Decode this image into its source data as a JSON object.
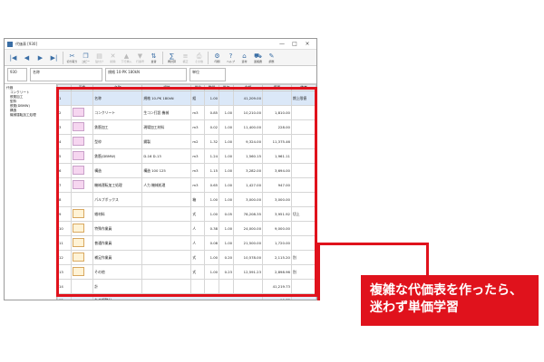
{
  "window": {
    "title": "代価表 [930]",
    "controls": [
      "—",
      "□",
      "×"
    ]
  },
  "toolbar": {
    "buttons": [
      {
        "icon": "first-icon",
        "glyph": "|◀",
        "label": "",
        "enabled": true
      },
      {
        "icon": "prev-icon",
        "glyph": "◀",
        "label": "",
        "enabled": true
      },
      {
        "icon": "next-icon",
        "glyph": "▶",
        "label": "",
        "enabled": true
      },
      {
        "icon": "last-icon",
        "glyph": "▶|",
        "label": "",
        "enabled": true
      },
      {
        "icon": "cut-icon",
        "glyph": "✂",
        "label": "切り取り",
        "enabled": true
      },
      {
        "icon": "copy-icon",
        "glyph": "❐",
        "label": "コピー",
        "enabled": true
      },
      {
        "icon": "paste-icon",
        "glyph": "▤",
        "label": "貼付け",
        "enabled": false
      },
      {
        "icon": "delete-icon",
        "glyph": "✕",
        "label": "削除",
        "enabled": false
      },
      {
        "icon": "insert-up-icon",
        "glyph": "▲",
        "label": "下行挿入",
        "enabled": false
      },
      {
        "icon": "insert-down-icon",
        "glyph": "▼",
        "label": "行番号",
        "enabled": false
      },
      {
        "icon": "sort-icon",
        "glyph": "⇅",
        "label": "並替",
        "enabled": true
      },
      {
        "icon": "calc-icon",
        "glyph": "∑",
        "label": "再計算",
        "enabled": true
      },
      {
        "icon": "unit-icon",
        "glyph": "≡",
        "label": "補正",
        "enabled": false
      },
      {
        "icon": "print-icon",
        "glyph": "⎙",
        "label": "その他",
        "enabled": false
      },
      {
        "icon": "settings-icon",
        "glyph": "⚙",
        "label": "印刷",
        "enabled": true
      },
      {
        "icon": "help-icon",
        "glyph": "?",
        "label": "ヘルプ",
        "enabled": true
      },
      {
        "icon": "material-icon",
        "glyph": "⌂",
        "label": "資材",
        "enabled": true
      },
      {
        "icon": "transport-icon",
        "glyph": "⛟",
        "label": "運搬費",
        "enabled": true
      },
      {
        "icon": "adjust-icon",
        "glyph": "✎",
        "label": "調整",
        "enabled": true
      }
    ]
  },
  "infobar": {
    "code_label": "930",
    "name_label": "名称",
    "spec_text": "規格 10-PK 180kN",
    "unit_label": "単位"
  },
  "tree": {
    "root": "代価",
    "items": [
      {
        "label": "コンクリート",
        "level": 1
      },
      {
        "label": "鉄筋加工",
        "level": 1
      },
      {
        "label": "型枠",
        "level": 1
      },
      {
        "label": "鉄筋(DBMW)",
        "level": 1
      },
      {
        "label": "構造",
        "level": 1
      },
      {
        "label": "機械運転加工処理",
        "level": 1
      }
    ]
  },
  "grid": {
    "columns": [
      "No",
      "画像",
      "名称",
      "規格",
      "単位",
      "数量",
      "単価",
      "金額",
      "摘要",
      "備考"
    ],
    "rows": [
      {
        "no": "1",
        "thumb": "blank",
        "name": "名称",
        "spec": "規格 10-PK 180kN",
        "unit": "組",
        "qty": "1.00",
        "price": "",
        "amount": "41,209.00",
        "note": "",
        "memo": "期上限値"
      },
      {
        "no": "2",
        "thumb": "box",
        "name": "コンクリート",
        "spec": "生コン打設 機械",
        "unit": "m3",
        "qty": "0.85",
        "price": "1.00",
        "amount": "10,210.00",
        "note": "1,810.00",
        "memo": ""
      },
      {
        "no": "3",
        "thumb": "box",
        "name": "鉄筋加工",
        "spec": "現場加工材料",
        "unit": "m3",
        "qty": "0.02",
        "price": "1.00",
        "amount": "11,400.00",
        "note": "228.00",
        "memo": ""
      },
      {
        "no": "4",
        "thumb": "box",
        "name": "型枠",
        "spec": "鋼製",
        "unit": "m2",
        "qty": "1.32",
        "price": "1.00",
        "amount": "9,324.00",
        "note": "11,375.46",
        "memo": ""
      },
      {
        "no": "5",
        "thumb": "box",
        "name": "鉄筋(DBMW)",
        "spec": "D-16 D-13",
        "unit": "m3",
        "qty": "1.24",
        "price": "1.00",
        "amount": "1,560.15",
        "note": "1,961.11",
        "memo": ""
      },
      {
        "no": "6",
        "thumb": "box",
        "name": "構造",
        "spec": "構造 100 125",
        "unit": "m3",
        "qty": "1.15",
        "price": "1.00",
        "amount": "3,282.00",
        "note": "3,694.00",
        "memo": ""
      },
      {
        "no": "7",
        "thumb": "box",
        "name": "機械運転加工処理",
        "spec": "人力 機械処理",
        "unit": "m3",
        "qty": "0.65",
        "price": "1.00",
        "amount": "1,427.00",
        "note": "947.00",
        "memo": ""
      },
      {
        "no": "8",
        "thumb": "blank",
        "name": "パルプボックス",
        "spec": "",
        "unit": "箱",
        "qty": "1.00",
        "price": "1.00",
        "amount": "3,000.00",
        "note": "3,000.00",
        "memo": ""
      },
      {
        "no": "9",
        "thumb": "person",
        "name": "雑材料",
        "spec": "",
        "unit": "式",
        "qty": "1.00",
        "price": "0.05",
        "amount": "78,208.35",
        "note": "3,951.92",
        "memo": "切上 "
      },
      {
        "no": "10",
        "thumb": "person",
        "name": "特殊作業員",
        "spec": "",
        "unit": "人",
        "qty": "0.38",
        "price": "1.00",
        "amount": "24,000.00",
        "note": "9,000.00",
        "memo": ""
      },
      {
        "no": "11",
        "thumb": "person",
        "name": "普通作業員",
        "spec": "",
        "unit": "人",
        "qty": "0.08",
        "price": "1.00",
        "amount": "21,500.00",
        "note": "1,720.00",
        "memo": ""
      },
      {
        "no": "12",
        "thumb": "person",
        "name": "補足作業員",
        "spec": "",
        "unit": "式",
        "qty": "1.00",
        "price": "0.20",
        "amount": "10,578.00",
        "note": "2,115.20",
        "memo": "別"
      },
      {
        "no": "13",
        "thumb": "person",
        "name": "その他",
        "spec": "",
        "unit": "式",
        "qty": "1.00",
        "price": "0.23",
        "amount": "12,591.23",
        "note": "2,898.96",
        "memo": "別"
      },
      {
        "no": "14",
        "thumb": "blank",
        "name": "計",
        "spec": "",
        "unit": "",
        "qty": "",
        "price": "",
        "amount": "",
        "note": "41,219.73",
        "memo": ""
      }
    ],
    "footer": {
      "no": "15",
      "name": "丸め調整分",
      "note": "-10.73"
    }
  },
  "callout": {
    "line1": "複雑な代価表を作ったら、",
    "line2": "迷わず単価学習"
  },
  "colors": {
    "accent_red": "#e0121c",
    "selected_row": "#dbe8f8",
    "thumb_pink": "#f6d6f0"
  }
}
